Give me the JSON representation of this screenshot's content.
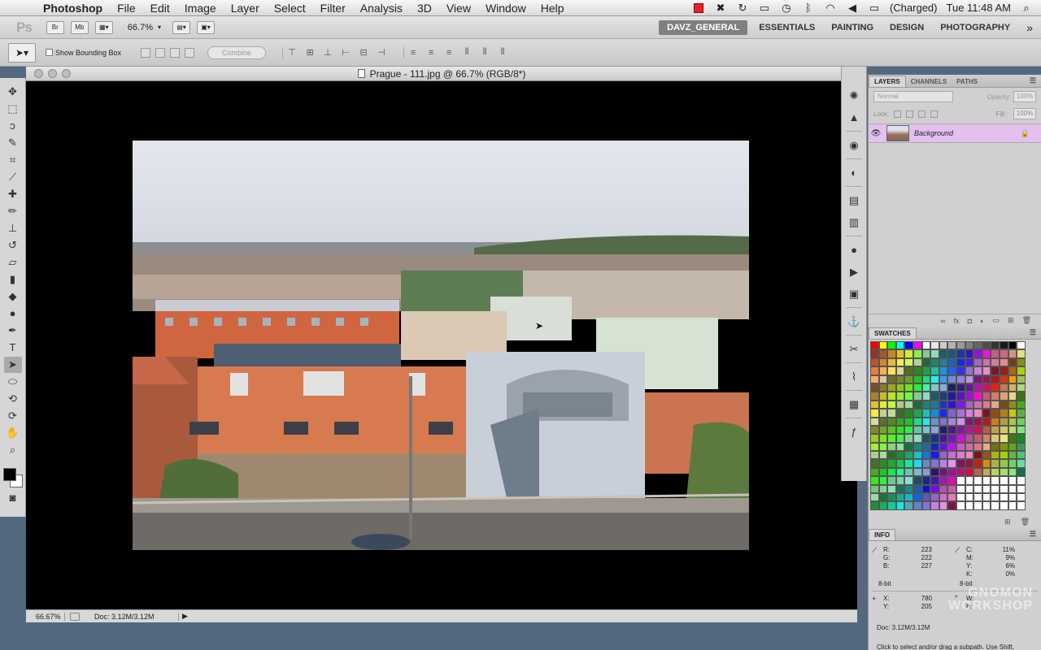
{
  "menubar": {
    "app_name": "Photoshop",
    "items": [
      "File",
      "Edit",
      "Image",
      "Layer",
      "Select",
      "Filter",
      "Analysis",
      "3D",
      "View",
      "Window",
      "Help"
    ],
    "battery_status": "(Charged)",
    "clock": "Tue 11:48 AM"
  },
  "appbar": {
    "logo": "Ps",
    "bridge_label": "Br",
    "minibridge_label": "Mb",
    "zoom": "66.7%",
    "workspaces": [
      "DAVZ_GENERAL",
      "ESSENTIALS",
      "PAINTING",
      "DESIGN",
      "PHOTOGRAPHY"
    ],
    "active_workspace": "DAVZ_GENERAL",
    "more": "»"
  },
  "optionsbar": {
    "show_bounding_box": "Show Bounding Box",
    "combine": "Combine"
  },
  "document": {
    "title": "Prague - 111.jpg @ 66.7% (RGB/8*)",
    "zoom": "66.67%",
    "doc_size": "Doc: 3.12M/3.12M"
  },
  "layers_panel": {
    "tabs": [
      "LAYERS",
      "CHANNELS",
      "PATHS"
    ],
    "blend_mode": "Normal",
    "opacity_label": "Opacity:",
    "opacity_value": "100%",
    "lock_label": "Lock:",
    "fill_label": "Fill:",
    "fill_value": "100%",
    "layer_name": "Background"
  },
  "swatches_panel": {
    "title": "SWATCHES"
  },
  "info_panel": {
    "title": "INFO",
    "rgb_labels": "R:\nG:\nB:",
    "rgb_values": "223\n222\n227",
    "cmyk_labels": "C:\nM:\nY:\nK:",
    "cmyk_values": "11%\n9%\n6%\n0%",
    "bit_left": "8-bit",
    "bit_right": "8-bit",
    "xy_labels": "X:\nY:",
    "xy_values": "780\n205",
    "wh_labels": "W:\nH:",
    "doc_size": "Doc: 3.12M/3.12M",
    "help_text": "Click to select and/or drag a subpath.  Use Shift,",
    "watermark_line1": "GNOMON",
    "watermark_line2": "WORKSHOP"
  },
  "colors": {
    "menubar_bg": "#e8e8e8",
    "canvas_bg": "#000000",
    "layer_selected": "#e3c0ef",
    "desktop": "#54697f"
  }
}
